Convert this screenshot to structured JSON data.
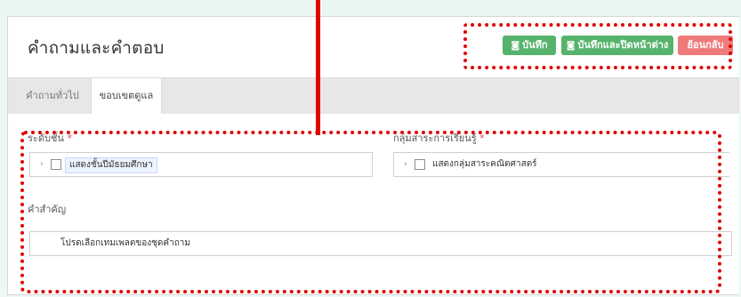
{
  "page": {
    "title": "คำถามและคำตอบ"
  },
  "toolbar": {
    "save_icon": "◙",
    "save_label": "บันทึก",
    "save_close_icon": "◙",
    "save_close_label": "บันทึกและปิดหน้าต่าง",
    "back_label": "ย้อนกลับ"
  },
  "tabs": [
    {
      "label": "คำถามทั่วไป"
    },
    {
      "label": "ขอบเขตดูแล"
    }
  ],
  "form": {
    "level_label": "ระดับชั้น",
    "level_required": "*",
    "level_value": "แสดงชั้นปีมัธยมศึกษา",
    "group_label": "กลุ่มสาระการเรียนรู้",
    "group_required": "*",
    "group_value": "แสดงกลุ่มสาระคณิตศาสตร์",
    "keyword_label": "คำสำคัญ",
    "keyword_value": "โปรดเลือกเทมเพลตของชุดคำถาม"
  },
  "icons": {
    "chevron": "chevron-right-icon",
    "checkbox": "checkbox-icon"
  },
  "colors": {
    "save_button": "#57b36b",
    "back_button": "#ef7a7a",
    "annotation": "#e10000"
  }
}
